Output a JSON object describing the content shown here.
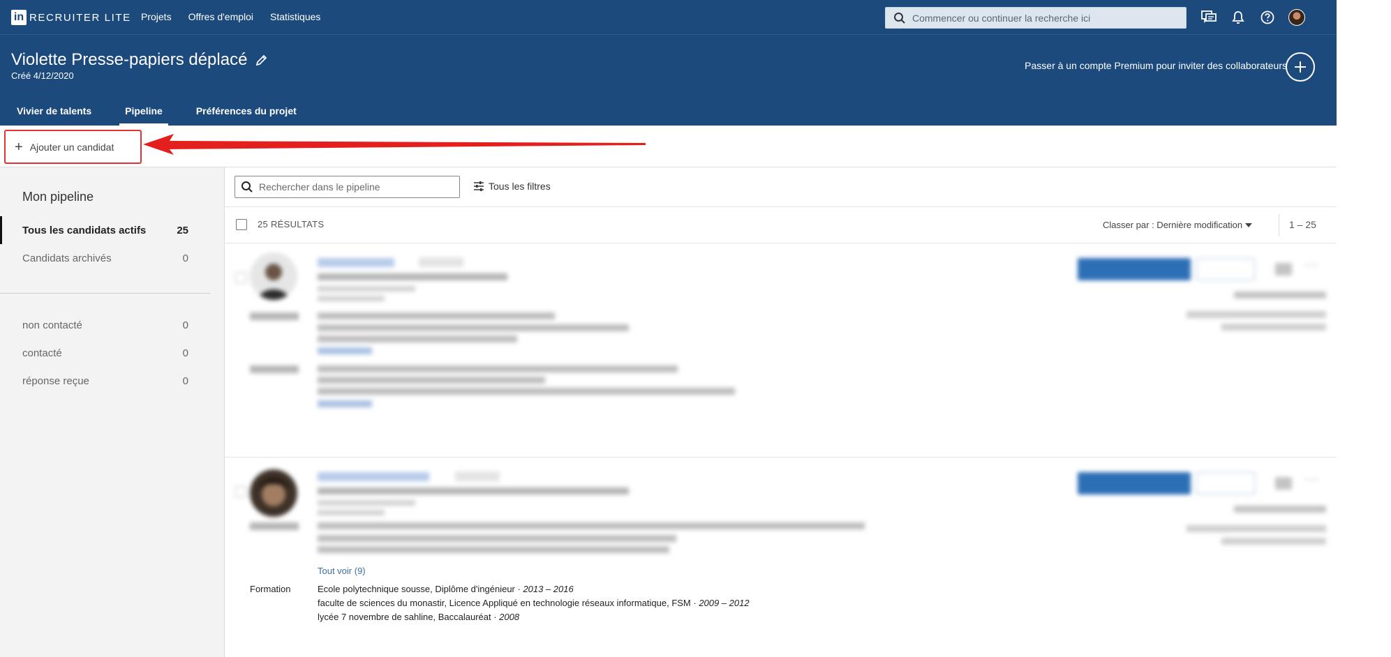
{
  "app": {
    "logo_letters": "in",
    "product": "RECRUITER LITE"
  },
  "nav": {
    "links": [
      "Projets",
      "Offres d'emploi",
      "Statistiques"
    ],
    "search_placeholder": "Commencer ou continuer la recherche ici"
  },
  "project": {
    "title": "Violette Presse-papiers déplacé",
    "created": "Créé 4/12/2020",
    "premium_text": "Passer à un compte Premium pour inviter des collaborateurs",
    "tabs": [
      "Vivier de talents",
      "Pipeline",
      "Préférences du projet"
    ],
    "active_tab": "Pipeline"
  },
  "actions": {
    "add_candidate": "Ajouter un candidat"
  },
  "sidebar": {
    "title": "Mon pipeline",
    "items": [
      {
        "label": "Tous les candidats actifs",
        "count": "25"
      },
      {
        "label": "Candidats archivés",
        "count": "0"
      }
    ],
    "stages": [
      {
        "label": "non contacté",
        "count": "0"
      },
      {
        "label": "contacté",
        "count": "0"
      },
      {
        "label": "réponse reçue",
        "count": "0"
      }
    ]
  },
  "main": {
    "search_placeholder": "Rechercher dans le pipeline",
    "filters_label": "Tous les filtres",
    "results_label": "25 RÉSULTATS",
    "sort_label": "Classer par : Dernière modification",
    "range": "1 – 25"
  },
  "candidate2": {
    "see_all": "Tout voir (9)",
    "education_label": "Formation",
    "education": [
      {
        "school": "Ecole polytechnique sousse, Diplôme d'ingénieur · ",
        "dates": "2013 – 2016"
      },
      {
        "school": "faculte de sciences du monastir, Licence Appliqué en technologie réseaux informatique, FSM · ",
        "dates": "2009 – 2012"
      },
      {
        "school": "lycée 7 novembre de sahline, Baccalauréat · ",
        "dates": "2008"
      }
    ]
  },
  "colors": {
    "brand": "#1c4a7d",
    "link": "#3b74b8",
    "highlight": "#e43131"
  }
}
